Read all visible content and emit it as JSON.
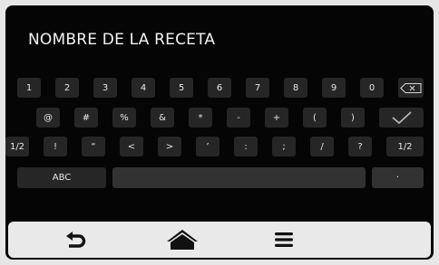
{
  "field": {
    "title": "NOMBRE DE LA RECETA"
  },
  "keyboard": {
    "row1": [
      "1",
      "2",
      "3",
      "4",
      "5",
      "6",
      "7",
      "8",
      "9",
      "0"
    ],
    "row2": [
      "@",
      "#",
      "%",
      "&",
      "*",
      "-",
      "+",
      "(",
      ")"
    ],
    "row3": [
      "1/2",
      "!",
      "“",
      "<",
      ">",
      "’",
      ":",
      ";",
      "/",
      "?",
      "1/2"
    ],
    "row4": {
      "abc": "ABC",
      "space": "",
      "dot": "·"
    },
    "icons": {
      "backspace": "backspace-icon",
      "enter": "check-icon"
    }
  },
  "navbar": {
    "icons": [
      "back-arrow-icon",
      "home-icon",
      "menu-icon"
    ]
  },
  "colors": {
    "screen": "#050505",
    "key": "#262626",
    "key_text": "#e6e6e6",
    "navbar": "#e9e9e9",
    "nav_icon": "#111111"
  }
}
